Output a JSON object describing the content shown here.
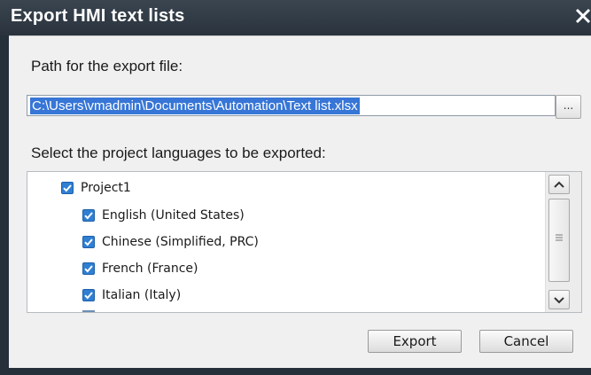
{
  "window": {
    "title": "Export HMI text lists",
    "close_glyph": "✕"
  },
  "path": {
    "label": "Path for the export file:",
    "value": "C:\\Users\\vmadmin\\Documents\\Automation\\Text list.xlsx",
    "browse_label": "..."
  },
  "languages": {
    "label": "Select the project languages to be exported:",
    "items": [
      {
        "label": "Project1",
        "checked": true,
        "level": 0
      },
      {
        "label": "English (United States)",
        "checked": true,
        "level": 1
      },
      {
        "label": "Chinese (Simplified, PRC)",
        "checked": true,
        "level": 1
      },
      {
        "label": "French (France)",
        "checked": true,
        "level": 1
      },
      {
        "label": "Italian (Italy)",
        "checked": true,
        "level": 1
      }
    ]
  },
  "buttons": {
    "export_label": "Export",
    "cancel_label": "Cancel"
  },
  "colors": {
    "titlebar": "#2a333d",
    "selection": "#3776d6",
    "checkbox": "#2f7fd2"
  }
}
